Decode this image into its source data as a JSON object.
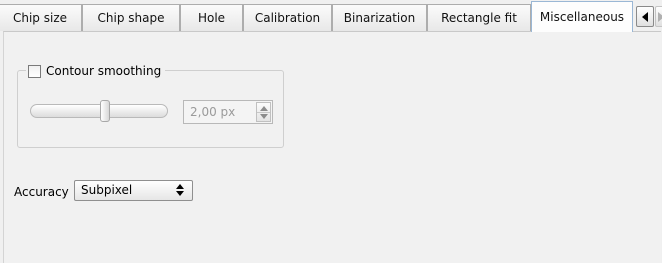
{
  "tabs": [
    {
      "label": "Chip size"
    },
    {
      "label": "Chip shape"
    },
    {
      "label": "Hole"
    },
    {
      "label": "Calibration"
    },
    {
      "label": "Binarization"
    },
    {
      "label": "Rectangle fit"
    },
    {
      "label": "Miscellaneous"
    }
  ],
  "contour_smoothing": {
    "label": "Contour smoothing",
    "checked": false,
    "slider_fraction": 0.55,
    "value": "2,00 px"
  },
  "accuracy": {
    "label": "Accuracy",
    "value": "Subpixel"
  },
  "icons": [
    "tab-scroll-left-icon",
    "tab-scroll-right-icon",
    "spin-up-icon",
    "spin-down-icon",
    "combo-arrows-icon"
  ]
}
